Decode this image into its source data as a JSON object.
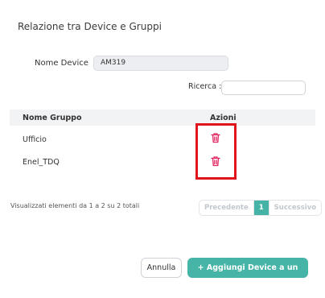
{
  "modal": {
    "title": "Relazione tra Device e Gruppi",
    "device_label": "Nome Device",
    "device_value": "AM319",
    "search_label": "Ricerca :",
    "search_value": ""
  },
  "table": {
    "columns": [
      "Nome Gruppo",
      "Azioni"
    ],
    "rows": [
      {
        "name": "Ufficio",
        "action_icon": "trash-icon"
      },
      {
        "name": "Enel_TDQ",
        "action_icon": "trash-icon"
      }
    ]
  },
  "pagination": {
    "info": "Visualizzati elementi da 1 a 2 su 2 totali",
    "prev": "Precedente",
    "current": "1",
    "next": "Successivo"
  },
  "footer": {
    "cancel_label": "Annulla",
    "add_label": "+ Aggiungi Device a un Gruppo"
  },
  "colors": {
    "accent": "#46b4a6",
    "trash": "#e0245e",
    "highlight_box": "#e0151b"
  }
}
